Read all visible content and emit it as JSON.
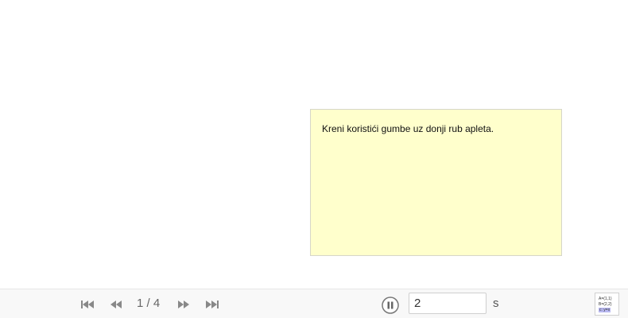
{
  "note": {
    "text": "Kreni koristići gumbe uz donji rub apleta."
  },
  "toolbar": {
    "step_counter": "1 / 4",
    "speed_value": "2",
    "speed_unit": "s",
    "buttons": {
      "first": "first-step-icon",
      "previous": "previous-step-icon",
      "next": "next-step-icon",
      "last": "last-step-icon",
      "pause": "pause-icon",
      "algebra": "algebra-view-icon"
    },
    "algebra_icon_lines": [
      "A=(1,1)",
      "B=(2,2)",
      "c: y=x"
    ]
  },
  "colors": {
    "note_background": "#ffffcc",
    "toolbar_background": "#f8f8f8",
    "icon_gray": "#888888"
  }
}
